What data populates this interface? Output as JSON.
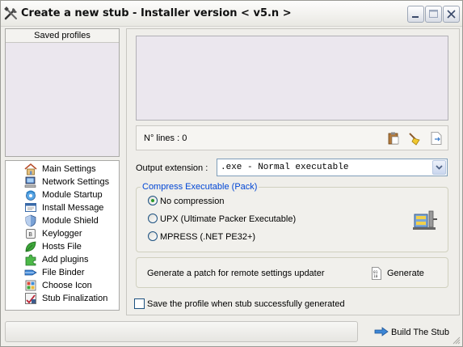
{
  "window": {
    "title": "Create a new stub - Installer version < v5.n >",
    "title_icon": "tools-icon",
    "controls": [
      "minimize",
      "maximize",
      "close"
    ]
  },
  "saved_profiles": {
    "header": "Saved profiles"
  },
  "nav": {
    "items": [
      {
        "label": "Main Settings",
        "icon": "house-icon"
      },
      {
        "label": "Network Settings",
        "icon": "network-computer-icon"
      },
      {
        "label": "Module Startup",
        "icon": "startup-icon"
      },
      {
        "label": "Install Message",
        "icon": "message-icon"
      },
      {
        "label": "Module Shield",
        "icon": "shield-icon"
      },
      {
        "label": "Keylogger",
        "icon": "keyboard-key-icon"
      },
      {
        "label": "Hosts File",
        "icon": "leaf-icon"
      },
      {
        "label": "Add plugins",
        "icon": "puzzle-icon"
      },
      {
        "label": "File Binder",
        "icon": "binder-icon"
      },
      {
        "label": "Choose Icon",
        "icon": "icon-picker-icon"
      },
      {
        "label": "Stub Finalization",
        "icon": "finalize-icon"
      }
    ]
  },
  "lines": {
    "label": "N° lines : 0",
    "actions": [
      "clipboard-paste-icon",
      "broom-clear-icon",
      "export-file-icon"
    ]
  },
  "output_extension": {
    "label": "Output extension :",
    "selected": ".exe - Normal executable"
  },
  "compress": {
    "legend": "Compress Executable (Pack)",
    "options": [
      {
        "label": "No compression",
        "selected": true
      },
      {
        "label": "UPX (Ultimate Packer Executable)",
        "selected": false
      },
      {
        "label": "MPRESS (.NET PE32+)",
        "selected": false
      }
    ],
    "icon": "compress-press-icon"
  },
  "patch": {
    "label": "Generate a patch for remote settings updater",
    "button": "Generate"
  },
  "save_profile": {
    "label": "Save the profile when stub successfully generated",
    "checked": false
  },
  "build": {
    "button": "Build The Stub"
  },
  "colors": {
    "accent_legend": "#0046d5",
    "panel_bg": "#ebe7ee",
    "window_bg": "#efeeea"
  }
}
